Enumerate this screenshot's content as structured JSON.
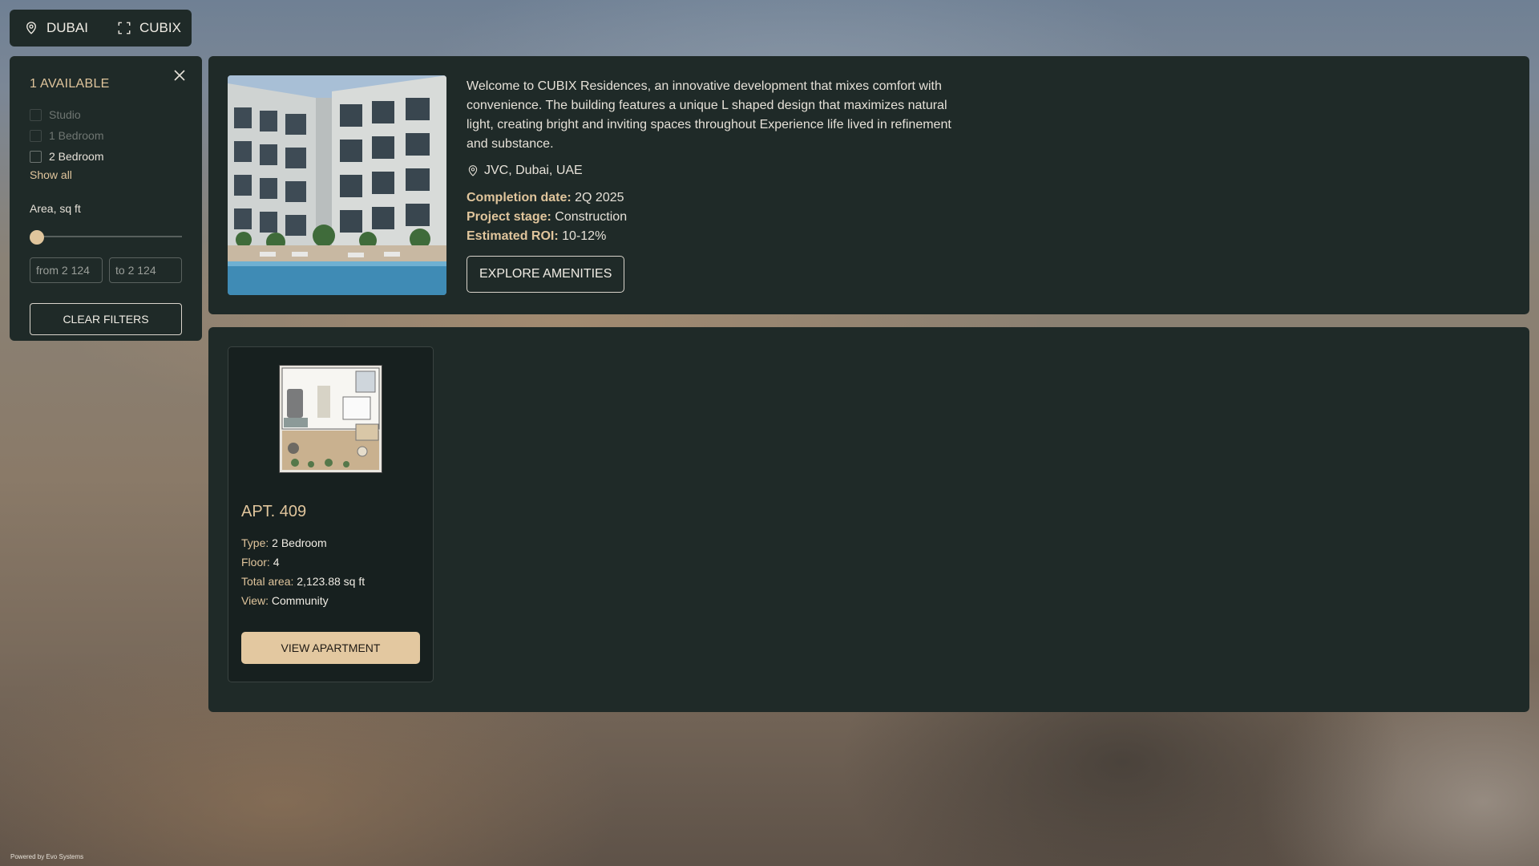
{
  "breadcrumb": {
    "city": "DUBAI",
    "project": "CUBIX"
  },
  "filters": {
    "available": "1 AVAILABLE",
    "types": [
      {
        "label": "Studio",
        "enabled": false
      },
      {
        "label": "1 Bedroom",
        "enabled": false
      },
      {
        "label": "2 Bedroom",
        "enabled": true
      }
    ],
    "show_all": "Show all",
    "area_label": "Area, sq ft",
    "from_placeholder": "from 2 124",
    "to_placeholder": "to 2 124",
    "clear": "CLEAR FILTERS"
  },
  "project": {
    "description": "Welcome to CUBIX Residences, an innovative development that mixes comfort with convenience. The building features a unique L shaped design that maximizes natural light, creating bright and inviting spaces throughout Experience life lived in refinement and substance.",
    "location": "JVC, Dubai, UAE",
    "completion_label": "Completion date:",
    "completion_value": "2Q 2025",
    "stage_label": "Project stage:",
    "stage_value": "Construction",
    "roi_label": "Estimated ROI:",
    "roi_value": "10-12%",
    "explore": "EXPLORE AMENITIES"
  },
  "unit": {
    "title": "APT. 409",
    "type_label": "Type:",
    "type_value": "2 Bedroom",
    "floor_label": "Floor:",
    "floor_value": "4",
    "area_label": "Total area:",
    "area_value": "2,123.88 sq ft",
    "view_label": "View:",
    "view_value": "Community",
    "button": "VIEW APARTMENT"
  },
  "footer": "Powered by Evo Systems",
  "colors": {
    "accent": "#e0c59c",
    "panel": "#1f2a28",
    "button_fill": "#e3c8a0"
  },
  "icons": [
    "location-pin-icon",
    "fullscreen-icon",
    "close-icon"
  ]
}
